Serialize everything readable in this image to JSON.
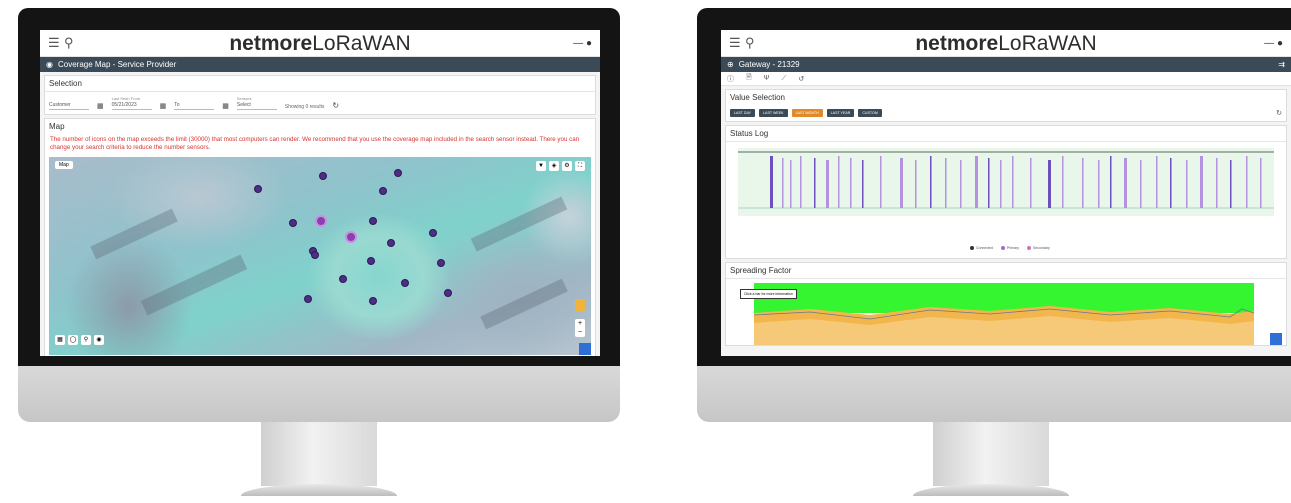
{
  "app": {
    "brand_bold": "netmore",
    "brand_light": "LoRaWAN",
    "user_text": "— "
  },
  "left": {
    "title": "Coverage Map - Service Provider",
    "selection": {
      "heading": "Selection",
      "fields": [
        {
          "label": "",
          "value": "Customer"
        },
        {
          "label": "Last Seen From",
          "value": "05/21/2023"
        },
        {
          "label": "",
          "value": "To"
        },
        {
          "label": "Sensors",
          "value": "Select"
        }
      ],
      "toggle_label": "Showing 0 results"
    },
    "map": {
      "heading": "Map",
      "warning": "The number of icons on the map exceeds the limit (30000) that most computers can render. We recommend that you use the coverage map included in the search sensor instead. There you can change your search criteria to reduce the number sensors.",
      "map_type_label": "Map",
      "zoom_in": "+",
      "zoom_out": "−"
    }
  },
  "right": {
    "title": "Gateway - 21329",
    "value_selection": {
      "heading": "Value Selection",
      "buttons": [
        {
          "label": "LAST DAY",
          "active": false
        },
        {
          "label": "LAST WEEK",
          "active": false
        },
        {
          "label": "LAST MONTH",
          "active": true
        },
        {
          "label": "LAST YEAR",
          "active": false
        },
        {
          "label": "CUSTOM",
          "active": false
        }
      ]
    },
    "status_log": {
      "heading": "Status Log",
      "legend": [
        "Connected",
        "Primary",
        "Secondary"
      ]
    },
    "spreading_factor": {
      "heading": "Spreading Factor",
      "tooltip": "Click a bar for more information"
    }
  },
  "colors": {
    "titlebar": "#3b4a57",
    "warning": "#d8332f",
    "active_button": "#e08a2a",
    "dot": "#4d2d87",
    "status_bar": "#9b6fd0",
    "sf_green": "#35f530",
    "sf_orange": "#f3b64d"
  }
}
